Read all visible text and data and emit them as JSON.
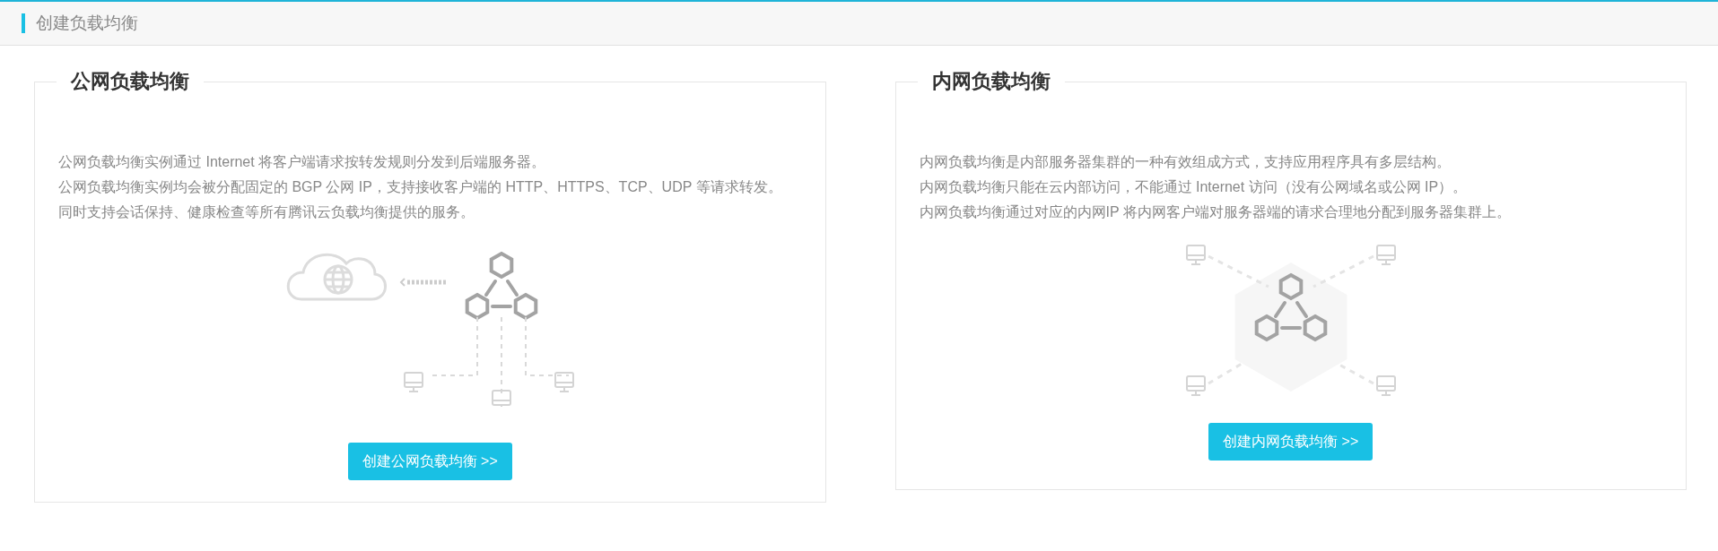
{
  "header": {
    "title": "创建负载均衡"
  },
  "cards": [
    {
      "kind": "public",
      "title": "公网负载均衡",
      "paragraphs": [
        "公网负载均衡实例通过 Internet 将客户端请求按转发规则分发到后端服务器。",
        "公网负载均衡实例均会被分配固定的 BGP 公网 IP，支持接收客户端的 HTTP、HTTPS、TCP、UDP 等请求转发。",
        "同时支持会话保持、健康检查等所有腾讯云负载均衡提供的服务。"
      ],
      "button": "创建公网负载均衡 >>"
    },
    {
      "kind": "private",
      "title": "内网负载均衡",
      "paragraphs": [
        "内网负载均衡是内部服务器集群的一种有效组成方式，支持应用程序具有多层结构。",
        "内网负载均衡只能在云内部访问，不能通过 Internet 访问（没有公网域名或公网 IP）。",
        "内网负载均衡通过对应的内网IP 将内网客户端对服务器端的请求合理地分配到服务器集群上。"
      ],
      "button": "创建内网负载均衡 >>"
    }
  ]
}
